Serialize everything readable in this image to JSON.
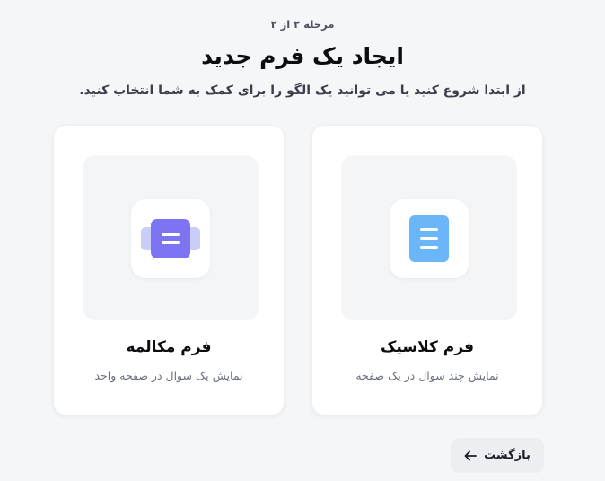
{
  "header": {
    "step": "مرحله ۲ از ۲",
    "title": "ایجاد یک فرم جدید",
    "subtitle": "از ابتدا شروع کنید یا می توانید یک الگو را برای کمک به شما انتخاب کنید."
  },
  "options": [
    {
      "title": "فرم کلاسیک",
      "description": "نمایش چند سوال در یک صفحه",
      "icon": "document-lines-icon",
      "color": "#6ab6f9"
    },
    {
      "title": "فرم مکالمه",
      "description": "نمایش یک سوال در صفحه واحد",
      "icon": "conversation-slides-icon",
      "color": "#7c74f2"
    }
  ],
  "footer": {
    "back_label": "بازگشت",
    "back_icon": "arrow-left-icon"
  }
}
